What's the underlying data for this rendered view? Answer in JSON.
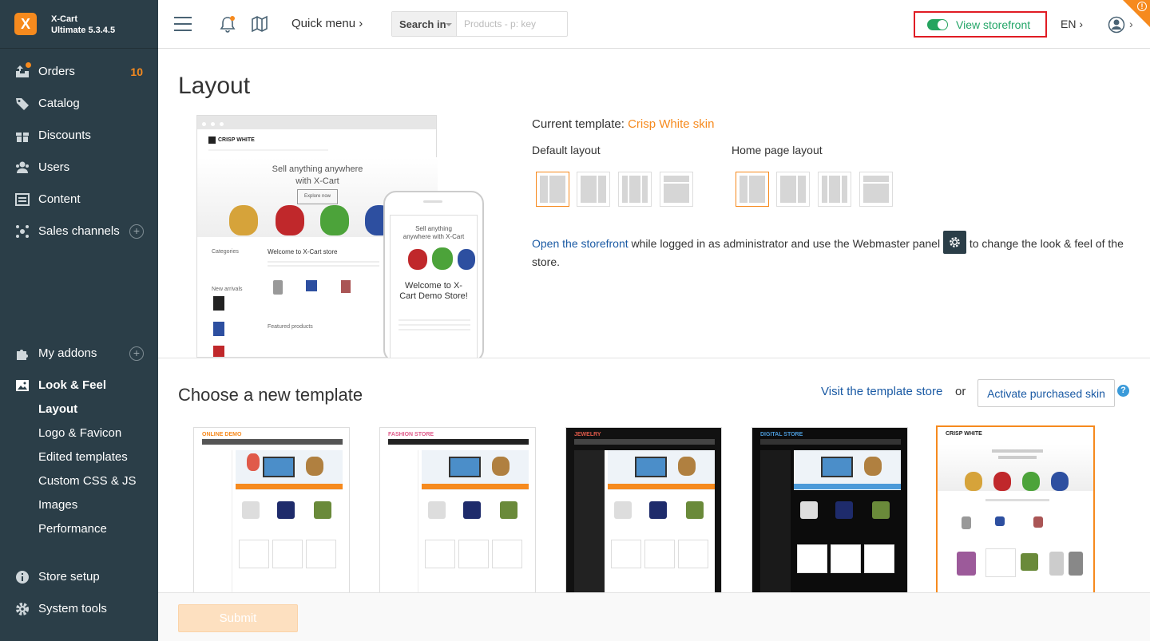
{
  "brand": {
    "name": "X-Cart",
    "version": "Ultimate 5.3.4.5"
  },
  "sidebar": {
    "items": [
      {
        "label": "Orders",
        "count": "10",
        "icon": "orders-icon"
      },
      {
        "label": "Catalog",
        "icon": "tag-icon"
      },
      {
        "label": "Discounts",
        "icon": "gift-icon"
      },
      {
        "label": "Users",
        "icon": "users-icon"
      },
      {
        "label": "Content",
        "icon": "content-icon"
      },
      {
        "label": "Sales channels",
        "icon": "sales-channels-icon"
      },
      {
        "label": "My addons",
        "icon": "puzzle-icon"
      },
      {
        "label": "Look & Feel",
        "icon": "image-icon"
      },
      {
        "label": "Store setup",
        "icon": "info-icon"
      },
      {
        "label": "System tools",
        "icon": "gear-icon"
      }
    ],
    "subitems": [
      "Layout",
      "Logo & Favicon",
      "Edited templates",
      "Custom CSS & JS",
      "Images",
      "Performance"
    ]
  },
  "topbar": {
    "quick_menu": "Quick menu",
    "search_in": "Search in",
    "search_placeholder": "Products - p: key",
    "view_storefront": "View storefront",
    "language": "EN"
  },
  "main": {
    "title": "Layout",
    "preview": {
      "store_name": "CRISP WHITE",
      "hero_text": "Sell anything anywhere with X-Cart",
      "hero_button": "Explore now",
      "welcome": "Welcome to X-Cart store",
      "categories": "Categories",
      "new_arrivals": "New arrivals",
      "featured": "Featured products",
      "phone_hero": "Sell anything anywhere with X-Cart",
      "phone_welcome": "Welcome to X-Cart Demo Store!"
    },
    "current_template_label": "Current template:",
    "current_template_name": "Crisp White skin",
    "default_layout_label": "Default layout",
    "home_layout_label": "Home page layout",
    "desc_link": "Open the storefront",
    "desc_text_1": "while logged in as administrator and use the Webmaster panel",
    "desc_text_2": "to change the look & feel of the store.",
    "choose_title": "Choose a new template",
    "visit_store": "Visit the template store",
    "or": "or",
    "activate": "Activate purchased skin",
    "templates": [
      {
        "name": "ONLINE DEMO"
      },
      {
        "name": "FASHION STORE"
      },
      {
        "name": "JEWELRY"
      },
      {
        "name": "DIGITAL STORE"
      },
      {
        "name": "CRISP WHITE"
      }
    ],
    "submit": "Submit"
  },
  "colors": {
    "accent": "#f68a1e",
    "sidebar": "#2b3e48",
    "link": "#1a5aa4",
    "green": "#25a45f"
  }
}
